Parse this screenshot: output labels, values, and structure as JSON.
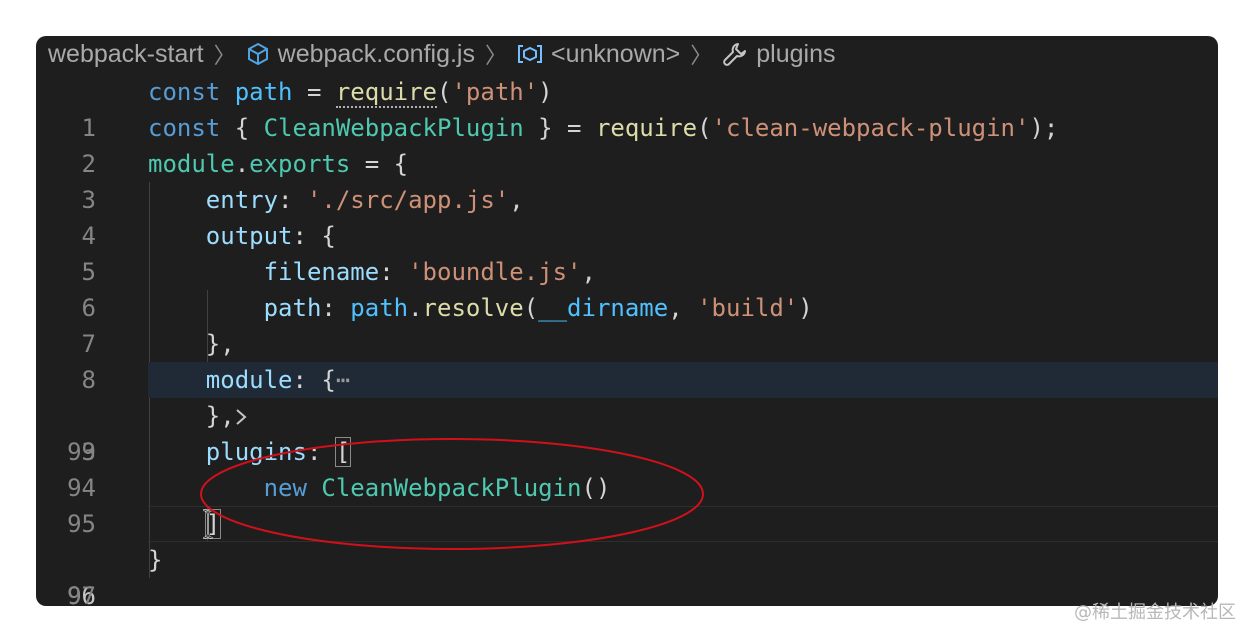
{
  "breadcrumb": {
    "project": "webpack-start",
    "file": "webpack.config.js",
    "symbol": "<unknown>",
    "member": "plugins",
    "file_icon": "package-cube-icon",
    "symbol_icon": "symbol-variable-icon",
    "member_icon": "wrench-icon"
  },
  "lines": [
    {
      "num": "1",
      "t1": "const",
      "t2": "path",
      "t3": " = ",
      "t4": "require",
      "t5": "(",
      "t6": "'path'",
      "t7": ")"
    },
    {
      "num": "2",
      "t1": "const",
      "t2": " { ",
      "t3": "CleanWebpackPlugin",
      "t4": " } = ",
      "t5": "require",
      "t6": "(",
      "t7": "'clean-webpack-plugin'",
      "t8": ");"
    },
    {
      "num": "3",
      "t1": "module",
      "t2": ".",
      "t3": "exports",
      "t4": " = {"
    },
    {
      "num": "4",
      "t1": "entry",
      "t2": ": ",
      "t3": "'./src/app.js'",
      "t4": ","
    },
    {
      "num": "5",
      "t1": "output",
      "t2": ": {"
    },
    {
      "num": "6",
      "t1": "filename",
      "t2": ": ",
      "t3": "'boundle.js'",
      "t4": ","
    },
    {
      "num": "7",
      "t1": "path",
      "t2": ": ",
      "t3": "path",
      "t4": ".",
      "t5": "resolve",
      "t6": "(",
      "t7": "__dirname",
      "t8": ", ",
      "t9": "'build'",
      "t10": ")"
    },
    {
      "num": "8",
      "t1": "},"
    },
    {
      "num": "9",
      "t1": "module",
      "t2": ": {",
      "t3": "⋯"
    },
    {
      "num": "93",
      "t1": "},"
    },
    {
      "num": "94",
      "t1": "plugins",
      "t2": ": ",
      "t3": "["
    },
    {
      "num": "95",
      "t1": "new",
      "t2": " ",
      "t3": "CleanWebpackPlugin",
      "t4": "()"
    },
    {
      "num": "96",
      "t1": "]"
    },
    {
      "num": "97",
      "t1": "}"
    }
  ],
  "watermark": "@稀土掘金技术社区",
  "colors": {
    "editor_bg": "#1e1e1e",
    "annotation": "#d0111b",
    "folded_highlight": "#1f2a36"
  }
}
